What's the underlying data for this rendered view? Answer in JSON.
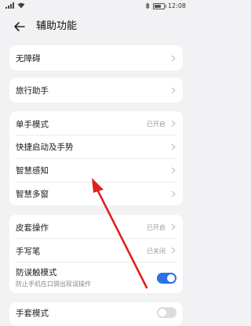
{
  "status_bar": {
    "time": "12:08",
    "signal_icon": "cellular-signal-icon",
    "wifi_icon": "wifi-icon",
    "battery_level_percent": 70
  },
  "header": {
    "back_icon": "back-arrow-icon",
    "title": "辅助功能"
  },
  "cards": [
    {
      "items": [
        {
          "label": "无障碍"
        }
      ]
    },
    {
      "items": [
        {
          "label": "旅行助手"
        }
      ]
    },
    {
      "items": [
        {
          "label": "单手模式",
          "value": "已开启"
        },
        {
          "label": "快捷启动及手势"
        },
        {
          "label": "智慧感知"
        },
        {
          "label": "智慧多窗"
        }
      ]
    },
    {
      "items": [
        {
          "label": "皮套操作",
          "value": "已开启"
        },
        {
          "label": "手写笔",
          "value": "已关闭"
        },
        {
          "label": "防误触模式",
          "sublabel": "防止手机在口袋出现误操作",
          "toggle_on": true
        }
      ]
    },
    {
      "items": [
        {
          "label": "手套模式",
          "toggle_on": false
        }
      ]
    }
  ],
  "annotation": {
    "arrow_color": "#e02020",
    "points_to": "智慧感知"
  },
  "colors": {
    "background": "#f2f2f4",
    "card": "#ffffff",
    "accent": "#2a72e8"
  }
}
